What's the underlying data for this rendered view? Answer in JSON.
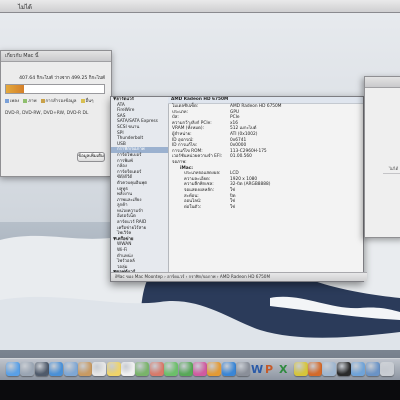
{
  "menubar": {
    "title": "ไม่ได้",
    "clock": ""
  },
  "about_window": {
    "title": "เกี่ยวกับ Mac นี้",
    "storage_caption": "407.64 กิกะไบต์ ว่างจาก 499.25 กิกะไบต์",
    "used_fraction": 0.18,
    "legend": [
      {
        "label": "เพลง",
        "color": "#7aa0d8"
      },
      {
        "label": "ภาพ",
        "color": "#8fbf6e"
      },
      {
        "label": "การสำรองข้อมูล",
        "color": "#c9a24a"
      },
      {
        "label": "อื่นๆ",
        "color": "#d8bf52"
      }
    ],
    "drive_text": "DVD-R, DVD-RW, DVD+RW, DVD-R DL",
    "more_button": "ข้อมูลเพิ่มเติม"
  },
  "sysinfo": {
    "sidebar": [
      {
        "label": "▼ฮาร์ดแวร์",
        "group": true
      },
      {
        "label": "ATA"
      },
      {
        "label": "FireWire"
      },
      {
        "label": "SAS"
      },
      {
        "label": "SATA/SATA Express"
      },
      {
        "label": "SCSI ขนาน"
      },
      {
        "label": "SPI"
      },
      {
        "label": "Thunderbolt"
      },
      {
        "label": "USB"
      },
      {
        "label": "กราฟิก/จอภาพ",
        "selected": true
      },
      {
        "label": "การ์ดไฟเบอร์"
      },
      {
        "label": "การพิมพ์"
      },
      {
        "label": "กล้อง"
      },
      {
        "label": "การ์ดรีดเดอร์"
      },
      {
        "label": "ซีดี/ดีวีดี"
      },
      {
        "label": "ตัวควบคุมอินพุต"
      },
      {
        "label": "บลูทูธ"
      },
      {
        "label": "พลังงาน"
      },
      {
        "label": "ภาพและเสียง"
      },
      {
        "label": "ลูกค้า"
      },
      {
        "label": "หน่วยความจำ"
      },
      {
        "label": "อีเธอร์เน็ต"
      },
      {
        "label": "ฮาร์ดแวร์ RAID"
      },
      {
        "label": "เครือข่ายไร้สาย"
      },
      {
        "label": "ไฟเวิร์ค"
      },
      {
        "label": "▼เครือข่าย",
        "group": true
      },
      {
        "label": "WWAN"
      },
      {
        "label": "Wi-Fi"
      },
      {
        "label": "ตำแหน่ง"
      },
      {
        "label": "ไฟร์วอลล์"
      },
      {
        "label": "วอลุ่ม"
      },
      {
        "label": "▼ซอฟต์แวร์",
        "group": true
      }
    ],
    "header": "AMD Radeon HD 6750M",
    "rows": [
      {
        "k": "โมเดลชิปเซ็ต:",
        "v": "AMD Radeon HD 6750M",
        "ind": 0
      },
      {
        "k": "ประเภท:",
        "v": "GPU",
        "ind": 0
      },
      {
        "k": "บัส:",
        "v": "PCIe",
        "ind": 0
      },
      {
        "k": "ความกว้างลิงก์ PCIe:",
        "v": "x16",
        "ind": 0
      },
      {
        "k": "VRAM (ทั้งหมด):",
        "v": "512 เมกะไบต์",
        "ind": 0
      },
      {
        "k": "ผู้จำหน่าย:",
        "v": "ATI (0x1002)",
        "ind": 0
      },
      {
        "k": "ID อุปกรณ์:",
        "v": "0x6741",
        "ind": 0
      },
      {
        "k": "ID การแก้ไข:",
        "v": "0x0000",
        "ind": 0
      },
      {
        "k": "การแก้ไข ROM:",
        "v": "113-C2960H-175",
        "ind": 0
      },
      {
        "k": "เวอร์ชันหน่วยความจำ EFI:",
        "v": "01.00.560",
        "ind": 0
      },
      {
        "k": "จอภาพ:",
        "v": "",
        "ind": 0
      },
      {
        "k": "iMac:",
        "v": "",
        "ind": 1,
        "sub": true
      },
      {
        "k": "ประเภทจอแสดงผล:",
        "v": "LCD",
        "ind": 2
      },
      {
        "k": "ความละเอียด:",
        "v": "1920 x 1080",
        "ind": 2
      },
      {
        "k": "ความลึกพิกเซล:",
        "v": "32-บิต (ARGB8888)",
        "ind": 2
      },
      {
        "k": "จอแสดงผลหลัก:",
        "v": "ใช่",
        "ind": 2
      },
      {
        "k": "สะท้อน:",
        "v": "ปิด",
        "ind": 2
      },
      {
        "k": "ออนไลน์:",
        "v": "ใช่",
        "ind": 2
      },
      {
        "k": "ต่อในตัว:",
        "v": "ใช่",
        "ind": 2
      }
    ],
    "pathbar": "iMac ของ Mac Moontep › ฮาร์ดแวร์ › กราฟิก/จอภาพ › AMD Radeon HD 6750M"
  },
  "rightwin": {
    "label": "ไม่ได้"
  },
  "dock_icons": [
    {
      "name": "finder-icon",
      "color": "#5aa0e6"
    },
    {
      "name": "launchpad-icon",
      "color": "#9aa5b3"
    },
    {
      "name": "mission-control-icon",
      "color": "#4f5a6a"
    },
    {
      "name": "safari-icon",
      "color": "#4a90d6"
    },
    {
      "name": "mail-icon",
      "color": "#7fa7d4"
    },
    {
      "name": "contacts-icon",
      "color": "#c89a62"
    },
    {
      "name": "calendar-icon",
      "color": "#e6e6e6"
    },
    {
      "name": "notes-icon",
      "color": "#efd46a"
    },
    {
      "name": "reminders-icon",
      "color": "#f1f1f1"
    },
    {
      "name": "maps-icon",
      "color": "#79b36a"
    },
    {
      "name": "photos-icon",
      "color": "#d87a6a"
    },
    {
      "name": "messages-icon",
      "color": "#6cbf6a"
    },
    {
      "name": "facetime-icon",
      "color": "#58a858"
    },
    {
      "name": "itunes-icon",
      "color": "#d05ba0"
    },
    {
      "name": "ibooks-icon",
      "color": "#e39a34"
    },
    {
      "name": "app-store-icon",
      "color": "#3a86d6"
    },
    {
      "name": "system-preferences-icon",
      "color": "#8a8f99"
    },
    {
      "name": "word-icon",
      "color": "#2a5aa8",
      "glyph": "W"
    },
    {
      "name": "powerpoint-icon",
      "color": "#c55a2a",
      "glyph": "P"
    },
    {
      "name": "excel-icon",
      "color": "#2f8a3f",
      "glyph": "X"
    },
    {
      "name": "chrome-icon",
      "color": "#d6c53a"
    },
    {
      "name": "firefox-icon",
      "color": "#d46a2a"
    },
    {
      "name": "preview-icon",
      "color": "#9fb6cf"
    },
    {
      "name": "terminal-icon",
      "color": "#2a2a2a"
    },
    {
      "name": "folder-icon",
      "color": "#6fa3d8"
    },
    {
      "name": "downloads-icon",
      "color": "#6a93c6"
    },
    {
      "name": "trash-icon",
      "color": "#c9cdd3"
    }
  ]
}
